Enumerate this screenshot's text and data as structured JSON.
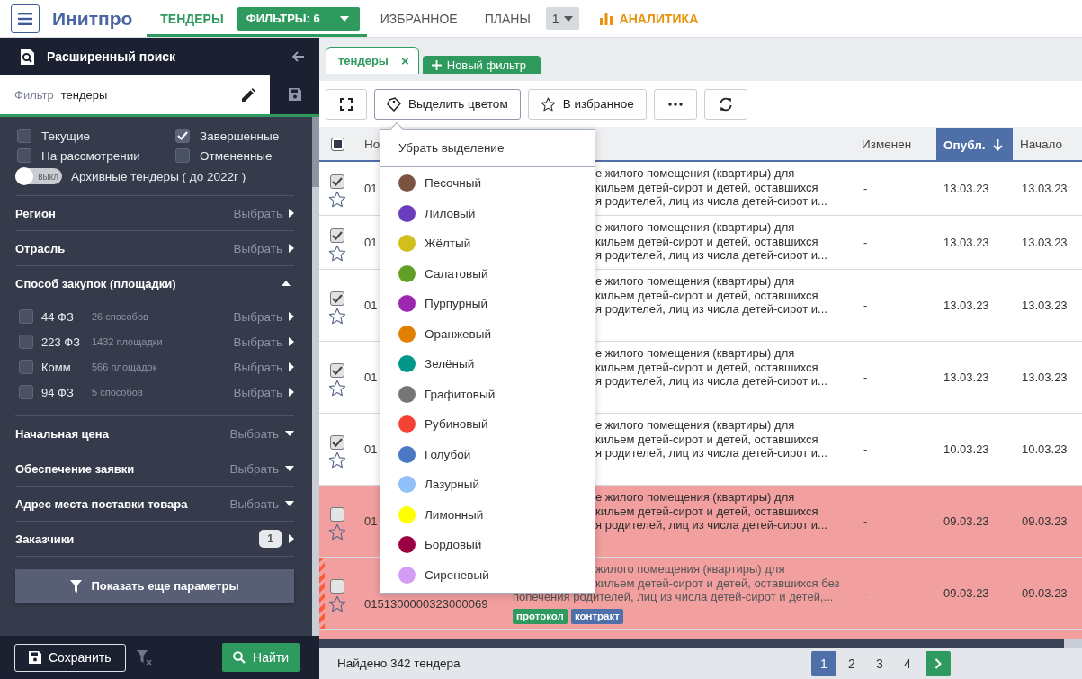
{
  "app": {
    "title": "Инитпро"
  },
  "nav": [
    {
      "label": "ТЕНДЕРЫ",
      "kind": "tab",
      "selected": true
    },
    {
      "label": "ФИЛЬТРЫ: 6",
      "kind": "dropdown",
      "selected": true
    },
    {
      "label": "ИЗБРАННОЕ",
      "kind": "tab",
      "selected": false
    },
    {
      "label": "ПЛАНЫ",
      "kind": "tab",
      "selected": false
    },
    {
      "label": "1",
      "kind": "select",
      "selected": false
    },
    {
      "label": "АНАЛИТИКА",
      "kind": "accent",
      "selected": false
    }
  ],
  "sidebar": {
    "title": "Расширенный поиск",
    "filter_label": "Фильтр",
    "filter_value": "тендеры",
    "statuses": [
      {
        "label": "Текущие",
        "checked": false
      },
      {
        "label": "Завершенные",
        "checked": true
      },
      {
        "label": "На рассмотрении",
        "checked": false
      },
      {
        "label": "Отмененные",
        "checked": false
      }
    ],
    "archive": {
      "label": "Архивные тендеры ( до 2022г )",
      "toggle_text": "выкл",
      "on": false
    },
    "sections": [
      {
        "title": "Регион",
        "kind": "link",
        "action": "Выбрать"
      },
      {
        "title": "Отрасль",
        "kind": "link",
        "action": "Выбрать"
      },
      {
        "title": "Способ закупок (площадки)",
        "kind": "group",
        "expanded": true,
        "children": [
          {
            "label": "44 ФЗ",
            "hint": "26 способов",
            "action": "Выбрать",
            "checked": false
          },
          {
            "label": "223 ФЗ",
            "hint": "1432 площадки",
            "action": "Выбрать",
            "checked": false
          },
          {
            "label": "Комм",
            "hint": "566 площадок",
            "action": "Выбрать",
            "checked": false
          },
          {
            "label": "94 ФЗ",
            "hint": "5 способов",
            "action": "Выбрать",
            "checked": false
          }
        ]
      },
      {
        "title": "Начальная цена",
        "kind": "menu",
        "action": "Выбрать"
      },
      {
        "title": "Обеспечение заявки",
        "kind": "menu",
        "action": "Выбрать"
      },
      {
        "title": "Адрес места поставки товара",
        "kind": "menu",
        "action": "Выбрать"
      },
      {
        "title": "Заказчики",
        "kind": "count",
        "count": "1"
      }
    ],
    "more_button": "Показать еще параметры",
    "save_button": "Сохранить",
    "find_button": "Найти"
  },
  "main": {
    "tabs": [
      {
        "label": "тендеры",
        "selected": true,
        "close": "×"
      }
    ],
    "new_tab": "Новый фильтр",
    "toolbar": [
      {
        "kind": "fullscreen"
      },
      {
        "kind": "color",
        "label": "Выделить цветом"
      },
      {
        "kind": "favorite",
        "label": "В избранное"
      },
      {
        "kind": "more"
      },
      {
        "kind": "refresh"
      }
    ],
    "table": {
      "select_all": {
        "indeterminate": true
      },
      "columns": [
        {
          "label": "Но",
          "sorted": false
        },
        {
          "sorted": false
        },
        {
          "label": "Изменен",
          "sorted": false
        },
        {
          "label": "Опубл.",
          "sorted": true
        },
        {
          "label": "Начало",
          "sorted": false
        }
      ],
      "rows": [
        {
          "checked": true,
          "starred": false,
          "number": "01",
          "subject": [
            "е жилого помещения (квартиры) для",
            "кильем детей-сирот и детей, оставшихся",
            "я родителей, лиц из числа детей-сирот и..."
          ],
          "changed": "-",
          "published": "13.03.23",
          "start": "13.03.23",
          "flagged": false,
          "tags": []
        },
        {
          "checked": true,
          "starred": false,
          "number": "01",
          "subject": [
            "е жилого помещения (квартиры) для",
            "кильем детей-сирот и детей, оставшихся",
            "я родителей, лиц из числа детей-сирот и..."
          ],
          "changed": "-",
          "published": "13.03.23",
          "start": "13.03.23",
          "flagged": false,
          "tags": []
        },
        {
          "checked": true,
          "starred": false,
          "number": "01",
          "subject": [
            "е жилого помещения (квартиры) для",
            "кильем детей-сирот и детей, оставшихся",
            "я родителей, лиц из числа детей-сирот и..."
          ],
          "changed": "-",
          "published": "13.03.23",
          "start": "13.03.23",
          "flagged": false,
          "tags": []
        },
        {
          "checked": true,
          "starred": false,
          "number": "01",
          "subject": [
            "е жилого помещения (квартиры) для",
            "кильем детей-сирот и детей, оставшихся",
            "я родителей, лиц из числа детей-сирот и..."
          ],
          "changed": "-",
          "published": "13.03.23",
          "start": "13.03.23",
          "flagged": false,
          "tags": []
        },
        {
          "checked": true,
          "starred": false,
          "number": "01",
          "subject": [
            "е жилого помещения (квартиры) для",
            "кильем детей-сирот и детей, оставшихся",
            "я родителей, лиц из числа детей-сирот и..."
          ],
          "changed": "-",
          "published": "10.03.23",
          "start": "10.03.23",
          "flagged": false,
          "tags": []
        },
        {
          "checked": false,
          "starred": false,
          "number": "01",
          "subject": [
            "е жилого помещения (квартиры) для",
            "кильем детей-сирот и детей, оставшихся",
            "я родителей, лиц из числа детей-сирот и..."
          ],
          "changed": "-",
          "published": "09.03.23",
          "start": "09.03.23",
          "color": "#f29f9f",
          "flagged": false,
          "tags": []
        },
        {
          "checked": false,
          "starred": false,
          "number": "0151300000323000069",
          "subject": [
            "жилого помещения (квартиры) для",
            "кильем детей-сирот и детей, оставшихся без",
            "попечения родителей, лиц из числа детей-сирот и детей,..."
          ],
          "changed": "-",
          "published": "09.03.23",
          "start": "09.03.23",
          "color": "#f29f9f",
          "flagged": true,
          "tags": [
            {
              "label": "протокол",
              "color": "#2e9a5e"
            },
            {
              "label": "контракт",
              "color": "#4f6fa8"
            }
          ]
        }
      ]
    },
    "color_menu": {
      "clear_label": "Убрать выделение",
      "options": [
        {
          "label": "Песочный",
          "color": "#7b5343"
        },
        {
          "label": "Лиловый",
          "color": "#6a3dbf"
        },
        {
          "label": "Жёлтый",
          "color": "#d2bf1e"
        },
        {
          "label": "Салатовый",
          "color": "#62a025"
        },
        {
          "label": "Пурпурный",
          "color": "#9c27b0"
        },
        {
          "label": "Оранжевый",
          "color": "#e08000"
        },
        {
          "label": "Зелёный",
          "color": "#009688"
        },
        {
          "label": "Графитовый",
          "color": "#767676"
        },
        {
          "label": "Рубиновый",
          "color": "#f44336"
        },
        {
          "label": "Голубой",
          "color": "#4a78c2"
        },
        {
          "label": "Лазурный",
          "color": "#90bff9"
        },
        {
          "label": "Лимонный",
          "color": "#ffff00"
        },
        {
          "label": "Бордовый",
          "color": "#9b0044"
        },
        {
          "label": "Сиреневый",
          "color": "#d39cf5"
        }
      ]
    },
    "footer": {
      "found": "Найдено 342 тендера",
      "pages": [
        {
          "label": "1",
          "selected": true
        },
        {
          "label": "2",
          "selected": false
        },
        {
          "label": "3",
          "selected": false
        },
        {
          "label": "4",
          "selected": false
        }
      ]
    }
  }
}
